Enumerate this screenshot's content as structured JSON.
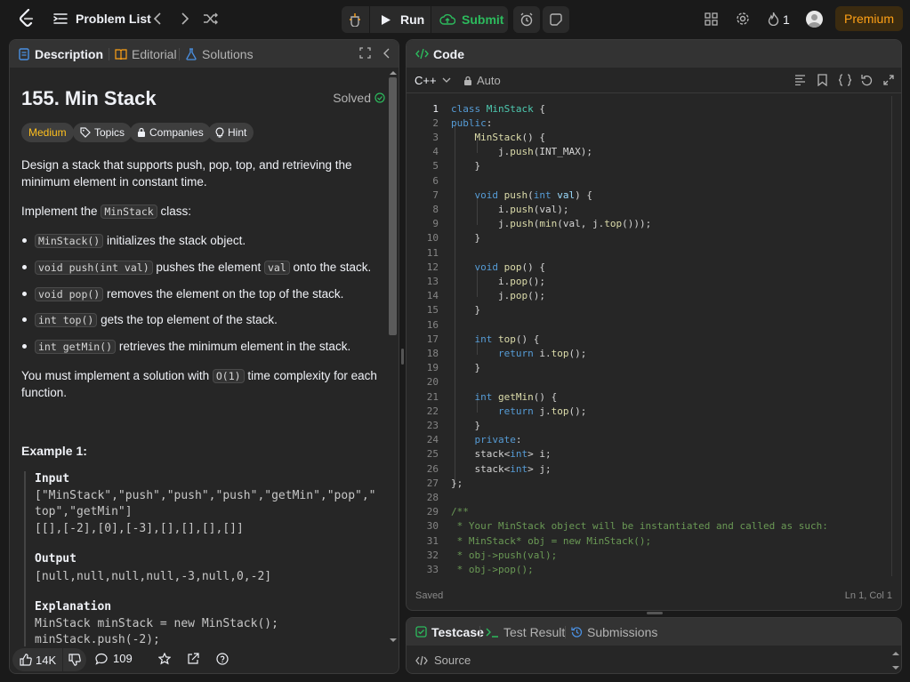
{
  "topbar": {
    "problem_list": "Problem List",
    "run": "Run",
    "submit": "Submit",
    "streak": "1",
    "premium": "Premium"
  },
  "left": {
    "tabs": [
      "Description",
      "Editorial",
      "Solutions"
    ],
    "title": "155. Min Stack",
    "solved": "Solved",
    "chips": [
      "Medium",
      "Topics",
      "Companies",
      "Hint"
    ],
    "intro_1": "Design a stack that supports push, pop, top, and retrieving the",
    "intro_2": "minimum element in constant time.",
    "impl_pre": "Implement the",
    "impl_code": "MinStack",
    "impl_post": "class:",
    "bullets": [
      {
        "code": "MinStack()",
        "text": " initializes the stack object."
      },
      {
        "code": "void push(int val)",
        "text": " pushes the element ",
        "code2": "val",
        "text2": " onto the stack."
      },
      {
        "code": "void pop()",
        "text": " removes the element on the top of the stack."
      },
      {
        "code": "int top()",
        "text": " gets the top element of the stack."
      },
      {
        "code": "int getMin()",
        "text": " retrieves the minimum element in the stack."
      }
    ],
    "req_1_pre": "You must implement a solution with",
    "req_1_code": "O(1)",
    "req_1_post": "time complexity for each",
    "req_2": "function.",
    "example_title": "Example 1:",
    "input_label": "Input",
    "input_1": "[\"MinStack\",\"push\",\"push\",\"push\",\"getMin\",\"pop\",\"",
    "input_2": "top\",\"getMin\"]",
    "input_3": "[[],[-2],[0],[-3],[],[],[],[]]",
    "output_label": "Output",
    "output_1": "[null,null,null,null,-3,null,0,-2]",
    "explanation_label": "Explanation",
    "expl_1": "MinStack minStack = new MinStack();",
    "expl_2": "minStack.push(-2);",
    "likes": "14K",
    "comments": "109"
  },
  "code": {
    "tab": "Code",
    "language": "C++",
    "auto": "Auto",
    "saved": "Saved",
    "cursor": "Ln 1, Col 1"
  },
  "test": {
    "tabs": [
      "Testcase",
      "Test Result",
      "Submissions"
    ],
    "source": "Source"
  },
  "colors": {
    "accent_orange": "#ffa116",
    "green": "#2cbb5d",
    "medium": "#ffc01e"
  }
}
